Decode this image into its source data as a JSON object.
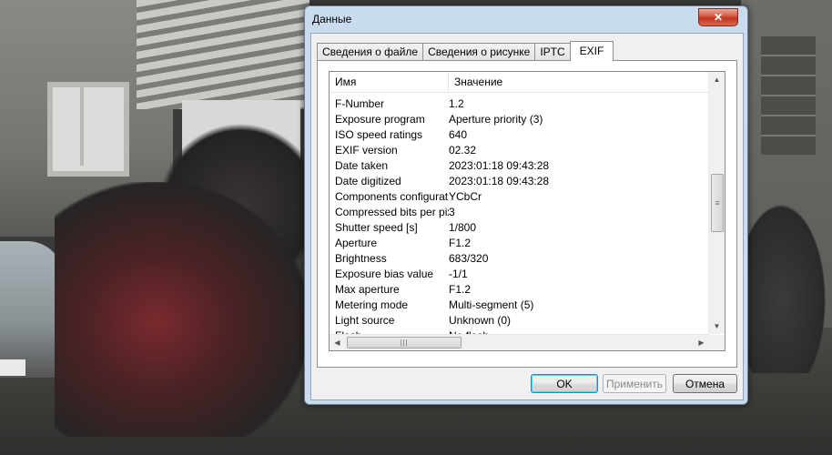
{
  "dialog": {
    "title": "Данные",
    "close_label": "✕",
    "tabs": [
      {
        "label": "Сведения о файле",
        "active": false
      },
      {
        "label": "Сведения о рисунке",
        "active": false
      },
      {
        "label": "IPTC",
        "active": false
      },
      {
        "label": "EXIF",
        "active": true
      }
    ],
    "table": {
      "columns": {
        "name": "Имя",
        "value": "Значение"
      },
      "rows": [
        {
          "name": "F-Number",
          "value": "1.2"
        },
        {
          "name": "Exposure program",
          "value": "Aperture priority (3)"
        },
        {
          "name": "ISO speed ratings",
          "value": "640"
        },
        {
          "name": "EXIF version",
          "value": "02.32"
        },
        {
          "name": "Date taken",
          "value": "2023:01:18 09:43:28"
        },
        {
          "name": "Date digitized",
          "value": "2023:01:18 09:43:28"
        },
        {
          "name": "Components configuration",
          "value": "YCbCr"
        },
        {
          "name": "Compressed bits per pixel",
          "value": "3"
        },
        {
          "name": "Shutter speed [s]",
          "value": "1/800"
        },
        {
          "name": "Aperture",
          "value": "F1.2"
        },
        {
          "name": "Brightness",
          "value": "683/320"
        },
        {
          "name": "Exposure bias value",
          "value": "-1/1"
        },
        {
          "name": "Max aperture",
          "value": "F1.2"
        },
        {
          "name": "Metering mode",
          "value": "Multi-segment (5)"
        },
        {
          "name": "Light source",
          "value": "Unknown (0)"
        },
        {
          "name": "Flash",
          "value": "No flash"
        }
      ]
    },
    "buttons": {
      "ok": "OK",
      "apply": "Применить",
      "cancel": "Отмена"
    }
  },
  "colors": {
    "title_bar": "#c9dced",
    "close_button": "#c0341d",
    "ok_border": "#3c7fb1"
  },
  "icons": {
    "scroll_up": "triangle-up",
    "scroll_down": "triangle-down",
    "scroll_left": "triangle-left",
    "scroll_right": "triangle-right"
  }
}
